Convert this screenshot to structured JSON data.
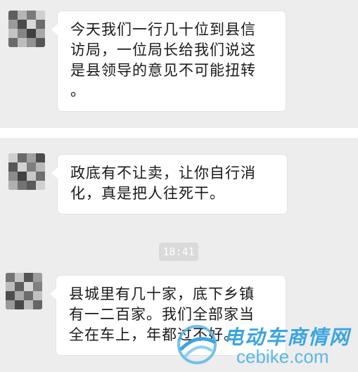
{
  "messages": [
    {
      "lines": [
        "今天我们一行几十位到县信",
        "访局，一位局长给我们说这",
        "是县领导的意见不可能扭转",
        "。"
      ]
    },
    {
      "lines": [
        "政底有不让卖，让你自行消",
        "化，真是把人往死干。"
      ]
    },
    {
      "lines": [
        "县城里有几十家，底下乡镇",
        "有一二百家。我们全部家当",
        "全在车上，年都过不好。"
      ]
    }
  ],
  "timestamp": "18:41",
  "watermark": {
    "title": "电动车商情网",
    "url": "cebike.com"
  },
  "colors": {
    "background": "#ededed",
    "bubble": "#ffffff",
    "watermark": "#3aa5e0"
  }
}
